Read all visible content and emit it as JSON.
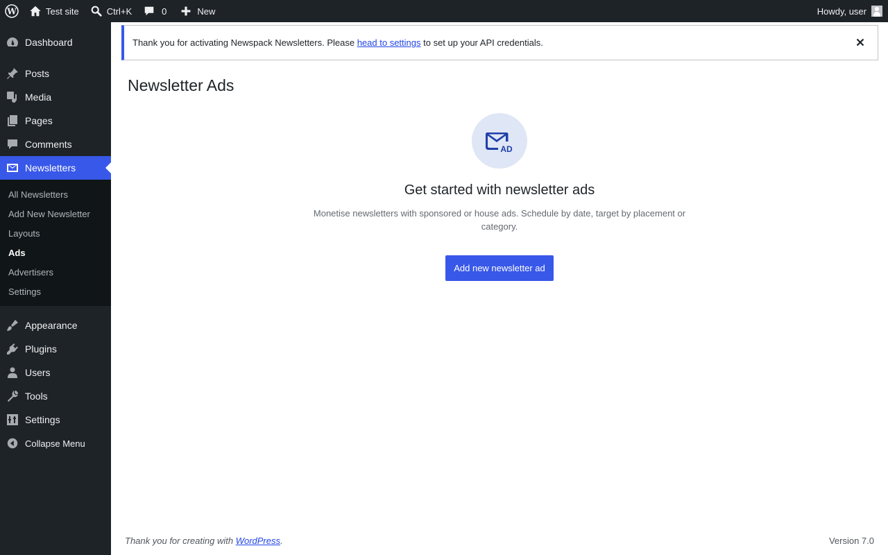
{
  "adminbar": {
    "wp_logo_icon": "wordpress-logo-icon",
    "site_name": "Test site",
    "search_shortcut": "Ctrl+K",
    "comments_count": "0",
    "new_label": "New",
    "greeting": "Howdy, user"
  },
  "sidebar": {
    "items": [
      {
        "label": "Dashboard",
        "icon": "dashboard-icon"
      },
      {
        "label": "Posts",
        "icon": "pin-icon"
      },
      {
        "label": "Media",
        "icon": "media-icon"
      },
      {
        "label": "Pages",
        "icon": "pages-icon"
      },
      {
        "label": "Comments",
        "icon": "comment-icon"
      },
      {
        "label": "Newsletters",
        "icon": "envelope-icon"
      },
      {
        "label": "Appearance",
        "icon": "brush-icon"
      },
      {
        "label": "Plugins",
        "icon": "plugin-icon"
      },
      {
        "label": "Users",
        "icon": "user-icon"
      },
      {
        "label": "Tools",
        "icon": "wrench-icon"
      },
      {
        "label": "Settings",
        "icon": "settings-icon"
      }
    ],
    "submenu": [
      "All Newsletters",
      "Add New Newsletter",
      "Layouts",
      "Ads",
      "Advertisers",
      "Settings"
    ],
    "collapse_label": "Collapse Menu"
  },
  "notice": {
    "text_before": "Thank you for activating Newspack Newsletters. Please ",
    "link_text": "head to settings",
    "text_after": " to set up your API credentials."
  },
  "page": {
    "title": "Newsletter Ads",
    "icon_text": "AD",
    "empty_heading": "Get started with newsletter ads",
    "empty_description": "Monetise newsletters with sponsored or house ads. Schedule by date, target by placement or category.",
    "add_button": "Add new newsletter ad"
  },
  "footer": {
    "text_before": "Thank you for creating with ",
    "link_text": "WordPress",
    "text_after": ".",
    "version": "Version 7.0"
  },
  "colors": {
    "accent": "#3858e9",
    "adminbar_bg": "#1d2327",
    "submenu_bg": "#101517",
    "icon_circle": "#dfe6f5"
  }
}
